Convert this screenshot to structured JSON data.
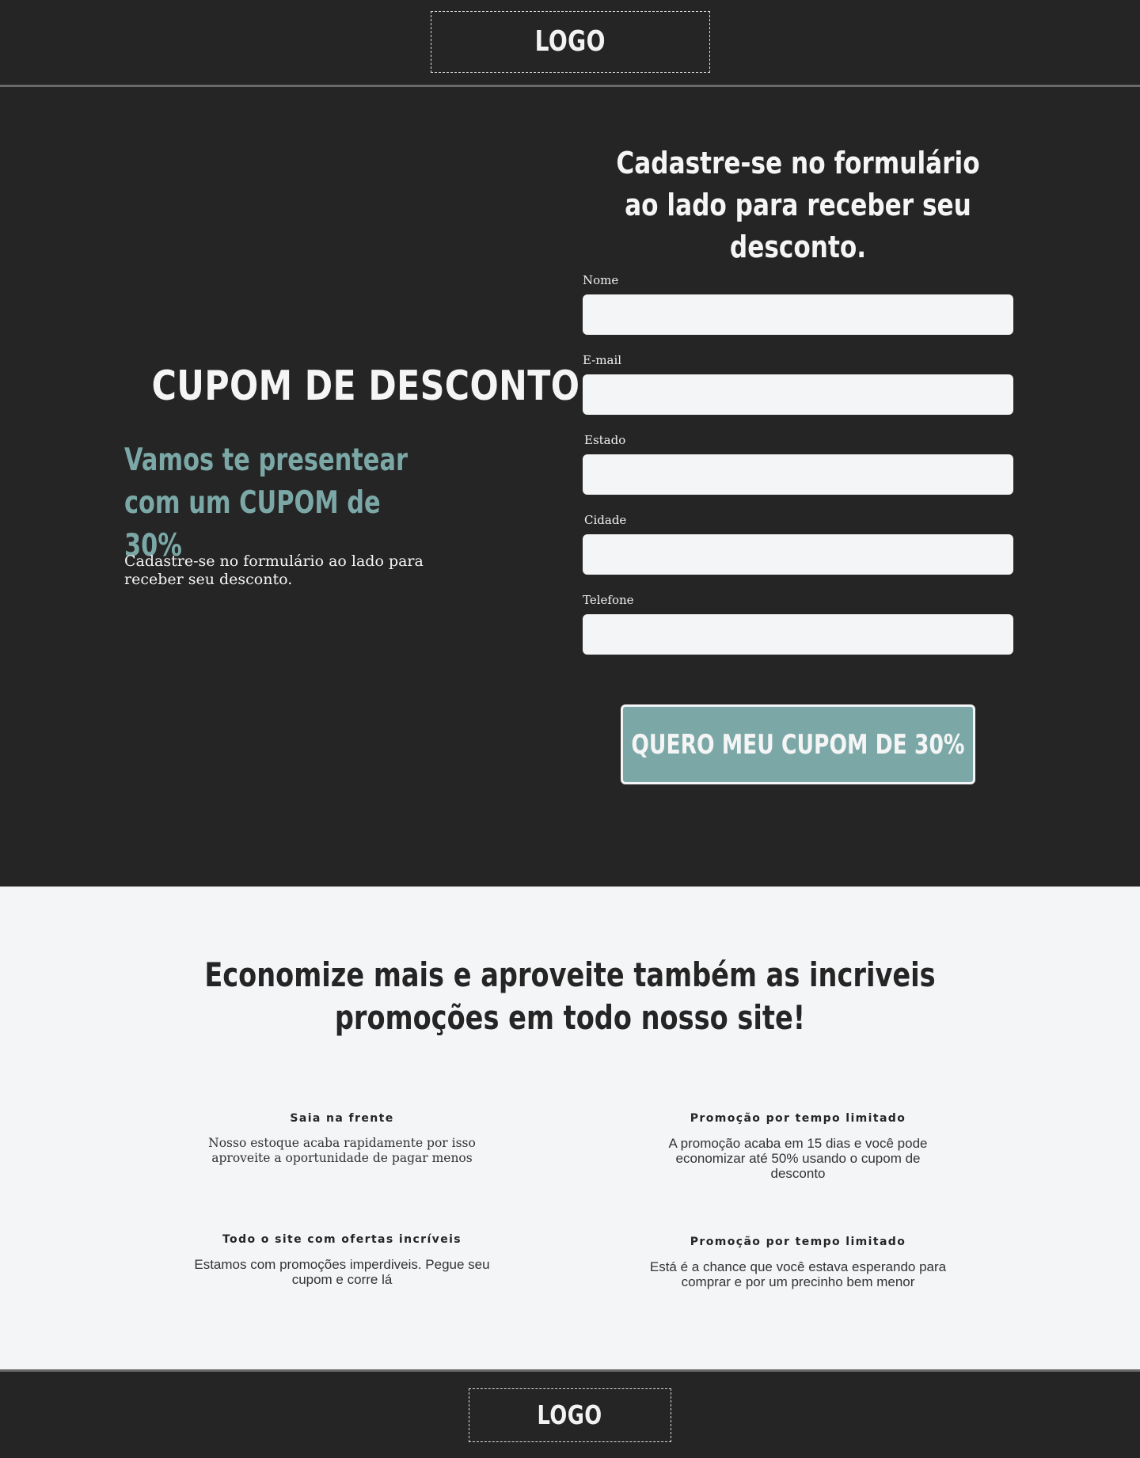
{
  "header": {
    "logo": "LOGO"
  },
  "hero": {
    "title": "CUPOM DE DESCONTO",
    "subtitle": "Vamos te presentear com um CUPOM de 30%",
    "description": "Cadastre-se no formulário ao lado para receber seu desconto."
  },
  "form": {
    "heading": "Cadastre-se no formulário ao lado para receber seu desconto.",
    "fields": [
      {
        "label": "Nome",
        "value": ""
      },
      {
        "label": "E-mail",
        "value": ""
      },
      {
        "label": "Estado",
        "value": ""
      },
      {
        "label": "Cidade",
        "value": ""
      },
      {
        "label": "Telefone",
        "value": ""
      }
    ],
    "submit_label": "QUERO MEU CUPOM DE 30%"
  },
  "promo": {
    "title": "Economize mais e aproveite também as incriveis promoções em todo nosso site!",
    "features": [
      {
        "title": "Saia na frente",
        "text": "Nosso estoque acaba rapidamente por isso aproveite a oportunidade de pagar menos"
      },
      {
        "title": "Promoção por tempo limitado",
        "text": "A promoção acaba em 15 dias e você pode economizar até 50% usando o cupom de desconto"
      },
      {
        "title": "Todo o site com ofertas incríveis",
        "text": "Estamos com promoções imperdiveis. Pegue seu cupom e corre lá"
      },
      {
        "title": "Promoção por tempo limitado",
        "text": "Está é a chance que você estava esperando para comprar e por um precinho bem menor"
      }
    ]
  },
  "footer": {
    "logo": "LOGO"
  },
  "colors": {
    "background_dark": "#252525",
    "background_light": "#f4f5f7",
    "accent": "#7ba8a7",
    "text_light": "#f5f5f5"
  }
}
